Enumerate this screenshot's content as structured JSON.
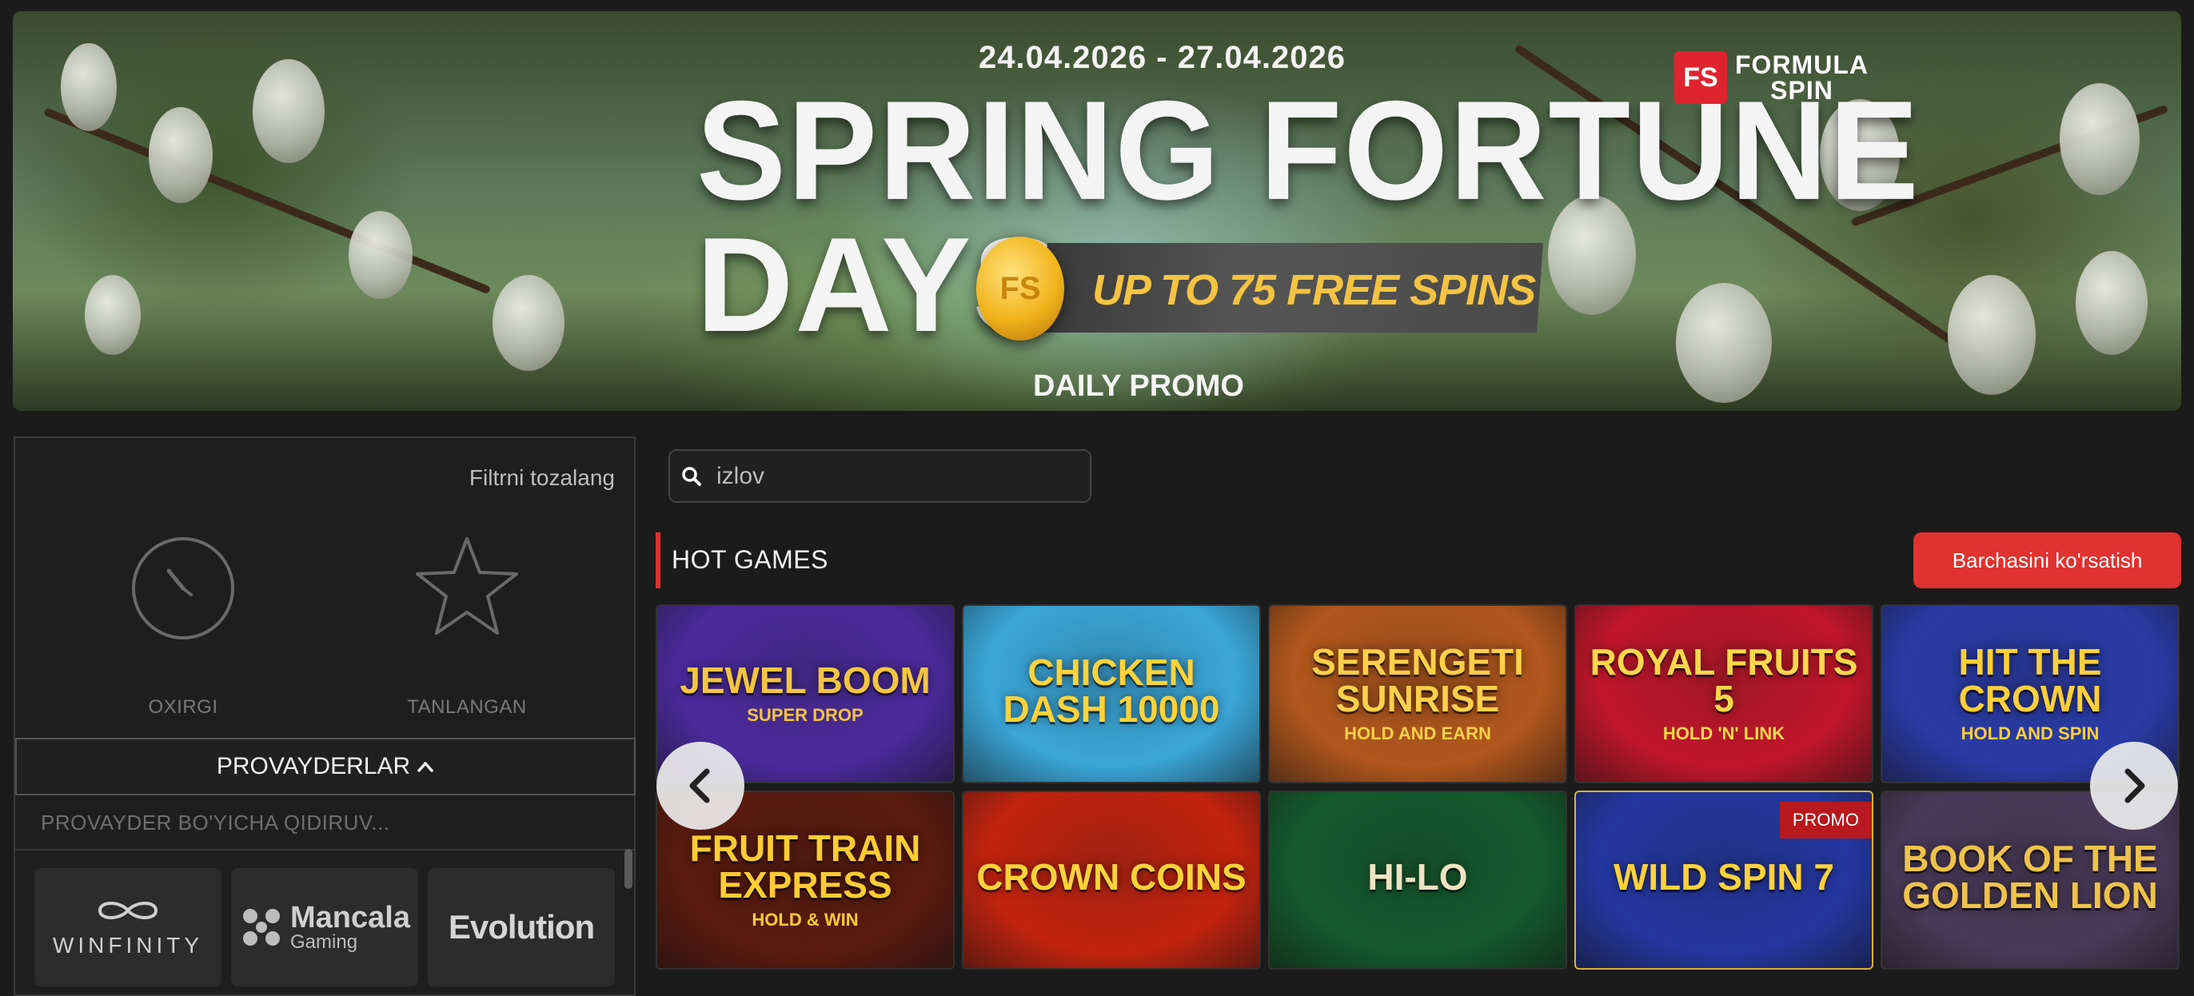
{
  "banner": {
    "date_range": "24.04.2026 - 27.04.2026",
    "title_line1": "SPRING FORTUNE",
    "title_line2": "DAYS",
    "offer": "UP TO 75 FREE SPINS",
    "subtitle": "DAILY PROMO",
    "logo_mark": "FS",
    "logo_text_line1": "FORMULA",
    "logo_text_line2": "SPIN",
    "coin_mark": "FS"
  },
  "filter": {
    "clear_label": "Filtrni tozalang",
    "recent_label": "OXIRGI",
    "favorites_label": "TANLANGAN",
    "providers_label": "PROVAYDERLAR",
    "providers_search_placeholder": "PROVAYDER BO'YICHA QIDIRUV...",
    "providers": [
      {
        "name": "WINFINITY"
      },
      {
        "name": "Mancala",
        "sub": "Gaming"
      },
      {
        "name": "Evolution"
      }
    ]
  },
  "search": {
    "placeholder": "izlov"
  },
  "section": {
    "title": "HOT GAMES",
    "see_all_label": "Barchasini ko'rsatish"
  },
  "games": [
    {
      "name": "JEWEL BOOM",
      "sub": "SUPER DROP",
      "bg": "#4b2a9c",
      "fg": "#f5c542"
    },
    {
      "name": "CHICKEN DASH 10000",
      "sub": "",
      "bg": "#3aa6d8",
      "fg": "#ffd23a"
    },
    {
      "name": "SERENGETI SUNRISE",
      "sub": "HOLD AND EARN",
      "bg": "#b2571d",
      "fg": "#ffd04a"
    },
    {
      "name": "ROYAL FRUITS 5",
      "sub": "HOLD 'N' LINK",
      "bg": "#c0162a",
      "fg": "#ffd84a"
    },
    {
      "name": "HIT THE CROWN",
      "sub": "HOLD AND SPIN",
      "bg": "#2a3ba8",
      "fg": "#ffcf3a"
    },
    {
      "name": "FRUIT TRAIN EXPRESS",
      "sub": "HOLD & WIN",
      "bg": "#5a1a0f",
      "fg": "#ffcc33"
    },
    {
      "name": "CROWN COINS",
      "sub": "",
      "bg": "#c2230f",
      "fg": "#ffd23a"
    },
    {
      "name": "HI-LO",
      "sub": "",
      "bg": "#145a2c",
      "fg": "#f1e3c2"
    },
    {
      "name": "WILD SPIN 7",
      "sub": "",
      "bg": "#2437a0",
      "fg": "#ffd23a",
      "badge": "PROMO"
    },
    {
      "name": "BOOK OF THE GOLDEN LION",
      "sub": "",
      "bg": "#4a3a5a",
      "fg": "#f0c24a"
    }
  ]
}
